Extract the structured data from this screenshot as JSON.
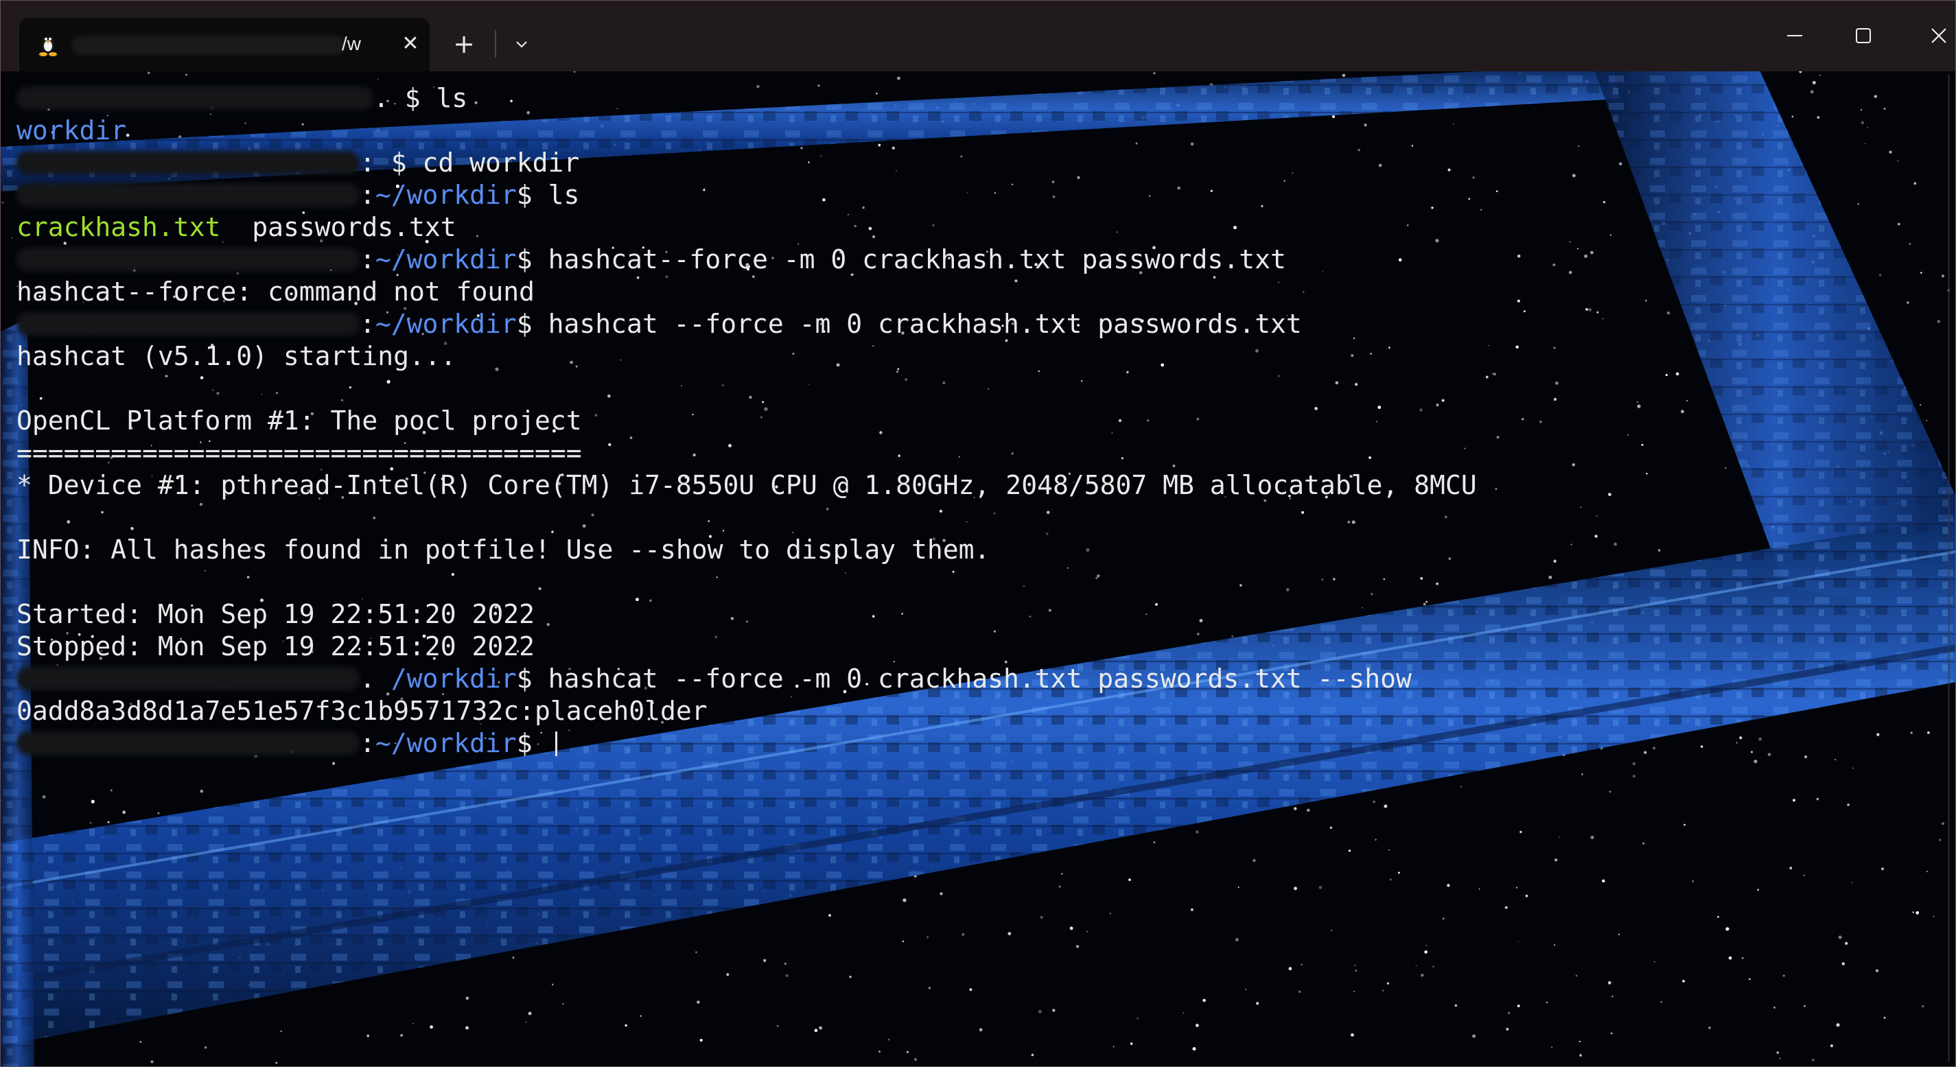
{
  "window": {
    "tab": {
      "title": "/w",
      "icon": "tux-penguin-icon"
    },
    "controls": {
      "new_tab": "+",
      "dropdown": "chevron-down-icon",
      "minimize": "minimize-icon",
      "maximize": "maximize-icon",
      "close": "close-icon",
      "tab_close": "✕"
    }
  },
  "terminal": {
    "lines": [
      {
        "prefix": ". $ ",
        "cmd": "ls"
      },
      {
        "output": "workdir",
        "kind": "dir"
      },
      {
        "prefix": ": $ ",
        "cmd": "cd workdir"
      },
      {
        "prefix": ":",
        "path": "~/workdir",
        "suffix": "$ ",
        "cmd": "ls"
      },
      {
        "files": [
          "crackhash.txt",
          "passwords.txt"
        ]
      },
      {
        "prefix": ":",
        "path": "~/workdir",
        "suffix": "$ ",
        "cmd": "hashcat--force -m 0 crackhash.txt passwords.txt"
      },
      {
        "output": "hashcat--force: command not found"
      },
      {
        "prefix": ":",
        "path": "~/workdir",
        "suffix": "$ ",
        "cmd": "hashcat --force -m 0 crackhash.txt passwords.txt"
      },
      {
        "output": "hashcat (v5.1.0) starting..."
      },
      {
        "output": ""
      },
      {
        "output": "OpenCL Platform #1: The pocl project"
      },
      {
        "output": "===================================="
      },
      {
        "output": "* Device #1: pthread-Intel(R) Core(TM) i7-8550U CPU @ 1.80GHz, 2048/5807 MB allocatable, 8MCU"
      },
      {
        "output": ""
      },
      {
        "output": "INFO: All hashes found in potfile! Use --show to display them."
      },
      {
        "output": ""
      },
      {
        "output": "Started: Mon Sep 19 22:51:20 2022"
      },
      {
        "output": "Stopped: Mon Sep 19 22:51:20 2022"
      },
      {
        "prefix": ". ",
        "path": "/workdir",
        "suffix": "$ ",
        "cmd": "hashcat --force -m 0 crackhash.txt passwords.txt --show"
      },
      {
        "output": "0add8a3d8d1a7e51e57f3c1b9571732c:placeh0lder"
      },
      {
        "prefix": ":",
        "path": "~/workdir",
        "suffix": "$ ",
        "cmd": ""
      }
    ]
  },
  "colors": {
    "titlebar": "#201a1d",
    "directory": "#5a8df0",
    "file_highlight": "#9ee02a",
    "text": "#eaeaea"
  }
}
